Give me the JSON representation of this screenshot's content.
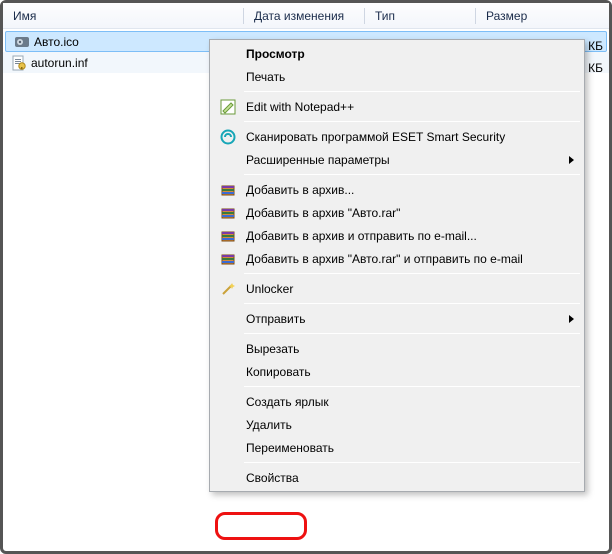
{
  "columns": {
    "name": "Имя",
    "date": "Дата изменения",
    "type": "Тип",
    "size": "Размер"
  },
  "files": [
    {
      "name": "Авто.ico",
      "sizeSuffix": "КБ"
    },
    {
      "name": "autorun.inf",
      "sizeSuffix": "КБ"
    }
  ],
  "menu": {
    "view": "Просмотр",
    "print": "Печать",
    "notepad": "Edit with Notepad++",
    "eset": "Сканировать программой ESET Smart Security",
    "advanced": "Расширенные параметры",
    "rar_add": "Добавить в архив...",
    "rar_add_name": "Добавить в архив \"Авто.rar\"",
    "rar_email": "Добавить в архив и отправить по e-mail...",
    "rar_name_email": "Добавить в архив \"Авто.rar\" и отправить по e-mail",
    "unlocker": "Unlocker",
    "send_to": "Отправить",
    "cut": "Вырезать",
    "copy": "Копировать",
    "shortcut": "Создать ярлык",
    "delete": "Удалить",
    "rename": "Переименовать",
    "properties": "Свойства"
  }
}
